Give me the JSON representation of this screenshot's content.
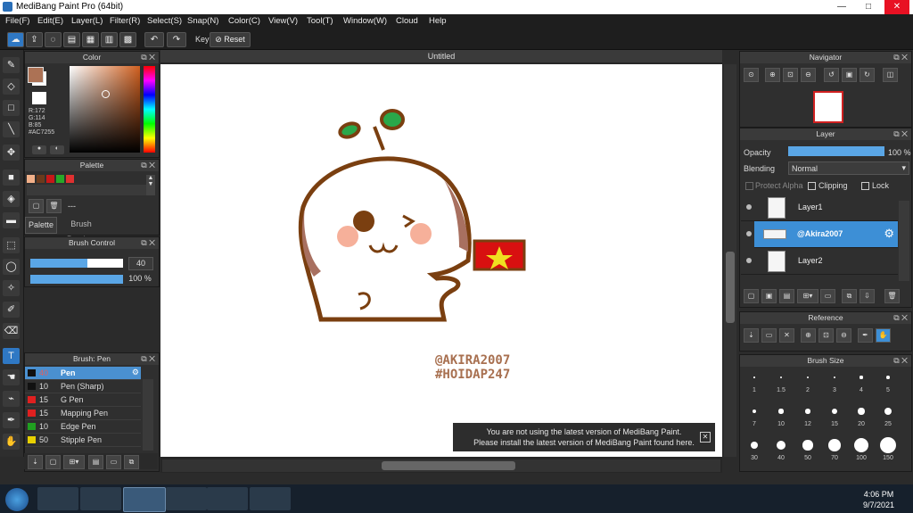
{
  "window": {
    "title": "MediBang Paint Pro (64bit)",
    "min": "—",
    "max": "□",
    "close": "✕"
  },
  "menu": [
    "File(F)",
    "Edit(E)",
    "Layer(L)",
    "Filter(R)",
    "Select(S)",
    "Snap(N)",
    "Color(C)",
    "View(V)",
    "Tool(T)",
    "Window(W)",
    "Cloud",
    "Help"
  ],
  "toolbar": {
    "key_label": "Key",
    "reset_label": "Reset"
  },
  "color_panel": {
    "title": "Color",
    "r": "R:172",
    "g": "G:114",
    "b": "B:85",
    "hex": "#AC7255",
    "fg": "#ac7255",
    "bg": "#ffffff"
  },
  "palette_panel": {
    "title": "Palette",
    "swatches": [
      "#f2b089",
      "#6b3a1c",
      "#c81818",
      "#28a828",
      "#e03030"
    ],
    "empty": "---",
    "tab_palette": "Palette",
    "tab_preview": "Brush Preview"
  },
  "brush_control": {
    "title": "Brush Control",
    "size": "40",
    "opacity": "100 %",
    "size_fill": 0.62,
    "opacity_fill": 1.0
  },
  "brush_panel": {
    "title": "Brush: Pen",
    "items": [
      {
        "size": "40",
        "name": "Pen",
        "color": "#111111"
      },
      {
        "size": "10",
        "name": "Pen (Sharp)",
        "color": "#111111"
      },
      {
        "size": "15",
        "name": "G Pen",
        "color": "#e02020"
      },
      {
        "size": "15",
        "name": "Mapping Pen",
        "color": "#e02020"
      },
      {
        "size": "10",
        "name": "Edge Pen",
        "color": "#20a020"
      },
      {
        "size": "50",
        "name": "Stipple Pen",
        "color": "#e8d000"
      }
    ]
  },
  "canvas": {
    "title": "Untitled",
    "line1": "@AKIRA2007",
    "line2": "#HOIDAP247"
  },
  "notice": {
    "line1": "You are not using the latest version of MediBang Paint.",
    "line2": "Please install the latest version of MediBang Paint found here.",
    "close": "✕"
  },
  "navigator": {
    "title": "Navigator"
  },
  "layer_panel": {
    "title": "Layer",
    "opacity_label": "Opacity",
    "opacity_value": "100 %",
    "blending_label": "Blending",
    "blending_value": "Normal",
    "protect_alpha": "Protect Alpha",
    "clipping": "Clipping",
    "lock": "Lock",
    "layers": [
      {
        "name": "Layer1"
      },
      {
        "name": "@Akira2007"
      },
      {
        "name": "Layer2"
      }
    ]
  },
  "reference": {
    "title": "Reference"
  },
  "brush_size": {
    "title": "Brush Size",
    "sizes": [
      "1",
      "1.5",
      "2",
      "3",
      "4",
      "5",
      "7",
      "10",
      "12",
      "15",
      "20",
      "25",
      "30",
      "40",
      "50",
      "70",
      "100",
      "150"
    ]
  },
  "taskbar": {
    "time": "4:06 PM",
    "date": "9/7/2021"
  }
}
